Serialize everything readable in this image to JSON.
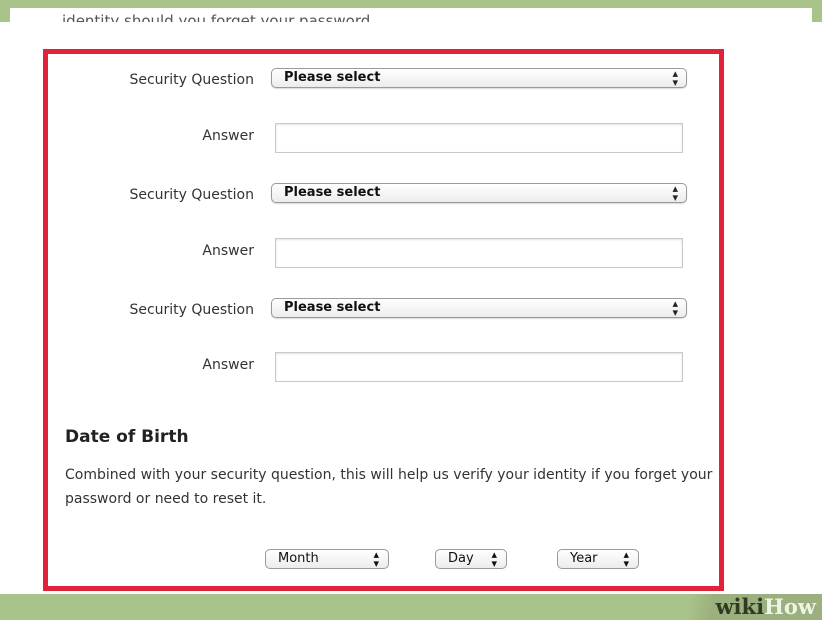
{
  "header": {
    "clipped_text": "identity should you forget your password."
  },
  "security": {
    "rows": [
      {
        "question_label": "Security Question",
        "selected": "Please select",
        "answer_label": "Answer",
        "answer_value": ""
      },
      {
        "question_label": "Security Question",
        "selected": "Please select",
        "answer_label": "Answer",
        "answer_value": ""
      },
      {
        "question_label": "Security Question",
        "selected": "Please select",
        "answer_label": "Answer",
        "answer_value": ""
      }
    ]
  },
  "dob": {
    "title": "Date of Birth",
    "description": "Combined with your security question, this will help us verify your identity if you forget your password or need to reset it.",
    "month": "Month",
    "day": "Day",
    "year": "Year"
  },
  "brand": {
    "wiki": "wiki",
    "how": "How"
  },
  "colors": {
    "highlight_border": "#e0233b",
    "band": "#a9c48a"
  },
  "icons": {
    "select_arrows": "up-down-arrows-icon"
  }
}
